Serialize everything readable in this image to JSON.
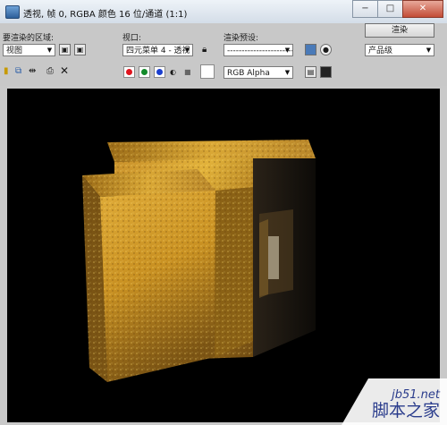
{
  "window": {
    "title": "透视, 帧 0, RGBA 颜色 16 位/通道 (1:1)"
  },
  "window_buttons": {
    "minimize": "−",
    "maximize": "□",
    "close": "✕"
  },
  "labels": {
    "area_to_render": "要渲染的区域:",
    "viewport": "视口:",
    "render_preset": "渲染预设:"
  },
  "controls": {
    "area_value": "视图",
    "viewport_value": "四元菜单 4 - 透视",
    "preset_value": "------------------------",
    "render_button": "渲染",
    "quality_value": "产品级",
    "channel_value": "RGB Alpha"
  },
  "colors": {
    "red": "#e0141e",
    "green": "#138a2a",
    "blue": "#1b3fcf",
    "accent": "#2a3c8c"
  },
  "watermark": {
    "site": "jb51.net",
    "name": "脚本之家"
  }
}
